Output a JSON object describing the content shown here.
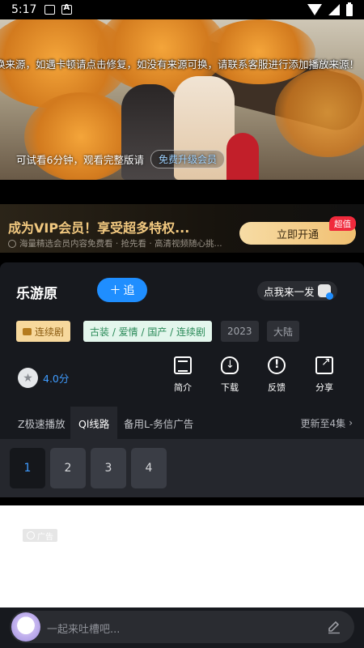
{
  "status_bar": {
    "time": "5:17"
  },
  "player": {
    "marquee": "换来源，如遇卡顿请点击修复，如没有来源可换，请联系客服进行添加播放来源！",
    "trial_text": "可试看6分钟，观看完整版请",
    "upgrade_label": "免费升级会员"
  },
  "vip_banner": {
    "title": "成为VIP会员！享受超多特权...",
    "subtitle": "海量精选会员内容免费看 · 抢先看 · 高清视频随心挑...",
    "button_label": "立即开通",
    "tag": "超值"
  },
  "show": {
    "title": "乐游原",
    "follow_label": "追",
    "random_label": "点我来一发",
    "tags": {
      "type": "连续剧",
      "genre": "古装 / 爱情 / 国产 / 连续剧",
      "year": "2023",
      "region": "大陆"
    },
    "rating": "4.0分"
  },
  "actions": [
    {
      "label": "简介",
      "icon": "intro-icon"
    },
    {
      "label": "下载",
      "icon": "download-icon"
    },
    {
      "label": "反馈",
      "icon": "feedback-icon"
    },
    {
      "label": "分享",
      "icon": "share-icon"
    }
  ],
  "sources": {
    "tabs": [
      "Z极速播放",
      "Ql线路",
      "备用L-务信广告"
    ],
    "active": 1,
    "update_info": "更新至4集"
  },
  "episodes": {
    "items": [
      "1",
      "2",
      "3",
      "4"
    ],
    "active": 0
  },
  "ad": {
    "badge": "广告"
  },
  "comment": {
    "placeholder": "一起来吐槽吧..."
  },
  "colors": {
    "accent": "#1f8eff",
    "vip_gold": "#f2c980",
    "panel_bg": "#17191e"
  }
}
